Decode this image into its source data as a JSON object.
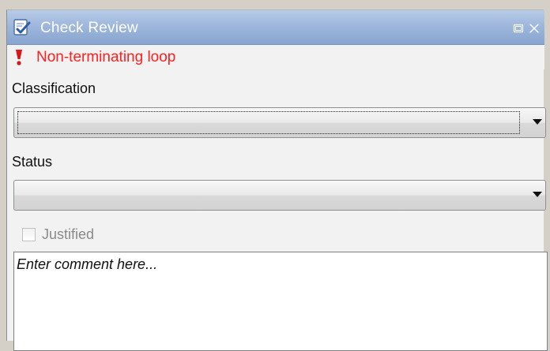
{
  "window": {
    "title": "Check Review",
    "app_icon": "check-review-icon",
    "restore_icon": "restore-icon",
    "close_icon": "close-icon"
  },
  "warning": {
    "icon": "exclamation-icon",
    "text": "Non-terminating loop",
    "color": "#ff2020"
  },
  "classification": {
    "label": "Classification",
    "value": "",
    "icon": "chevron-down-icon"
  },
  "status": {
    "label": "Status",
    "value": "",
    "icon": "chevron-down-icon"
  },
  "justified": {
    "label": "Justified",
    "checked": false,
    "enabled": false
  },
  "comment": {
    "placeholder": "Enter comment here...",
    "value": ""
  },
  "colors": {
    "titlebar": "#9eb7dc",
    "panel_background": "#f2f2f2",
    "warning_text": "#ff2020"
  }
}
